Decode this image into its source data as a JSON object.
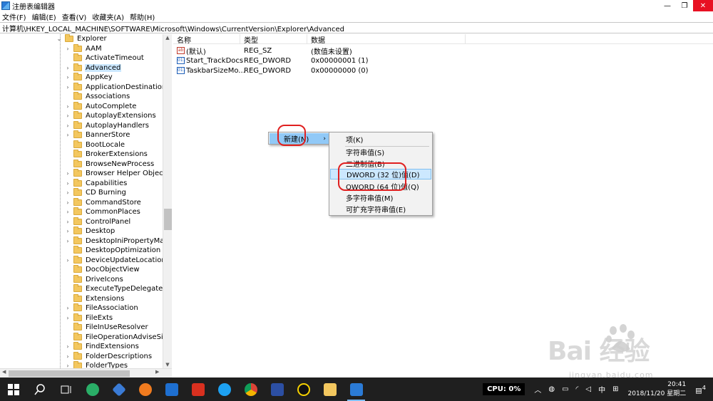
{
  "window": {
    "title": "注册表编辑器",
    "minimize": "—",
    "maximize": "❐",
    "close": "✕"
  },
  "menu": [
    {
      "label": "文件(F)"
    },
    {
      "label": "编辑(E)"
    },
    {
      "label": "查看(V)"
    },
    {
      "label": "收藏夹(A)"
    },
    {
      "label": "帮助(H)"
    }
  ],
  "address": "计算机\\HKEY_LOCAL_MACHINE\\SOFTWARE\\Microsoft\\Windows\\CurrentVersion\\Explorer\\Advanced",
  "tree": {
    "root": "Explorer",
    "items": [
      {
        "label": "AAM",
        "exp": "›"
      },
      {
        "label": "ActivateTimeout",
        "exp": ""
      },
      {
        "label": "Advanced",
        "exp": "›"
      },
      {
        "label": "AppKey",
        "exp": "›"
      },
      {
        "label": "ApplicationDestinations",
        "exp": "›"
      },
      {
        "label": "Associations",
        "exp": ""
      },
      {
        "label": "AutoComplete",
        "exp": "›"
      },
      {
        "label": "AutoplayExtensions",
        "exp": "›"
      },
      {
        "label": "AutoplayHandlers",
        "exp": "›"
      },
      {
        "label": "BannerStore",
        "exp": "›"
      },
      {
        "label": "BootLocale",
        "exp": ""
      },
      {
        "label": "BrokerExtensions",
        "exp": ""
      },
      {
        "label": "BrowseNewProcess",
        "exp": ""
      },
      {
        "label": "Browser Helper Objects",
        "exp": "›"
      },
      {
        "label": "Capabilities",
        "exp": "›"
      },
      {
        "label": "CD Burning",
        "exp": "›"
      },
      {
        "label": "CommandStore",
        "exp": "›"
      },
      {
        "label": "CommonPlaces",
        "exp": "›"
      },
      {
        "label": "ControlPanel",
        "exp": "›"
      },
      {
        "label": "Desktop",
        "exp": "›"
      },
      {
        "label": "DesktopIniPropertyMap",
        "exp": "›"
      },
      {
        "label": "DesktopOptimization",
        "exp": ""
      },
      {
        "label": "DeviceUpdateLocations",
        "exp": "›"
      },
      {
        "label": "DocObjectView",
        "exp": ""
      },
      {
        "label": "DriveIcons",
        "exp": ""
      },
      {
        "label": "ExecuteTypeDelegates",
        "exp": ""
      },
      {
        "label": "Extensions",
        "exp": ""
      },
      {
        "label": "FileAssociation",
        "exp": "›"
      },
      {
        "label": "FileExts",
        "exp": "›"
      },
      {
        "label": "FileInUseResolver",
        "exp": ""
      },
      {
        "label": "FileOperationAdviseSink",
        "exp": ""
      },
      {
        "label": "FindExtensions",
        "exp": "›"
      },
      {
        "label": "FolderDescriptions",
        "exp": "›"
      },
      {
        "label": "FolderTypes",
        "exp": "›"
      }
    ]
  },
  "list": {
    "headers": {
      "name": "名称",
      "type": "类型",
      "data": "数据"
    },
    "rows": [
      {
        "name": "(默认)",
        "type": "REG_SZ",
        "data": "(数值未设置)",
        "icon": "ab"
      },
      {
        "name": "Start_TrackDocs",
        "type": "REG_DWORD",
        "data": "0x00000001 (1)",
        "icon": "011"
      },
      {
        "name": "TaskbarSizeMo...",
        "type": "REG_DWORD",
        "data": "0x00000000 (0)",
        "icon": "011"
      }
    ]
  },
  "context_menu": {
    "new_label": "新建(N)",
    "arrow": "›"
  },
  "submenu": [
    {
      "label": "项(K)"
    },
    {
      "label": "字符串值(S)"
    },
    {
      "label": "二进制值(B)"
    },
    {
      "label": "DWORD (32 位)值(D)"
    },
    {
      "label": "QWORD (64 位)值(Q)"
    },
    {
      "label": "多字符串值(M)"
    },
    {
      "label": "可扩充字符串值(E)"
    }
  ],
  "watermark": {
    "text": "Bai  经验",
    "url": "jingyan.baidu.com"
  },
  "taskbar": {
    "cpu": "CPU:  0%",
    "ime": "中",
    "time": "20:41",
    "date": "2018/11/20 星期二",
    "notify_count": "4"
  },
  "colors": {
    "accent": "#91c9f7",
    "annotation": "#e02020",
    "taskbar": "#1f1f1f"
  }
}
